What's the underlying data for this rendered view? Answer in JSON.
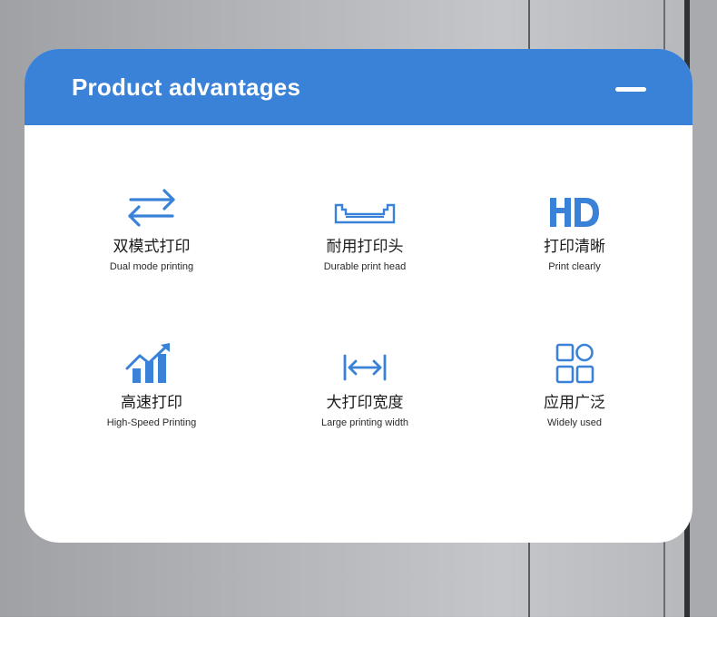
{
  "panel": {
    "title": "Product advantages",
    "accent_color": "#3a82d8"
  },
  "features": [
    {
      "icon": "swap-arrows-icon",
      "title_cn": "双模式打印",
      "title_en": "Dual mode printing"
    },
    {
      "icon": "print-head-icon",
      "title_cn": "耐用打印头",
      "title_en": "Durable print head"
    },
    {
      "icon": "hd-icon",
      "title_cn": "打印清晰",
      "title_en": "Print clearly"
    },
    {
      "icon": "growth-chart-icon",
      "title_cn": "高速打印",
      "title_en": "High-Speed Printing"
    },
    {
      "icon": "width-arrows-icon",
      "title_cn": "大打印宽度",
      "title_en": "Large printing width"
    },
    {
      "icon": "app-grid-icon",
      "title_cn": "应用广泛",
      "title_en": "Widely used"
    }
  ]
}
